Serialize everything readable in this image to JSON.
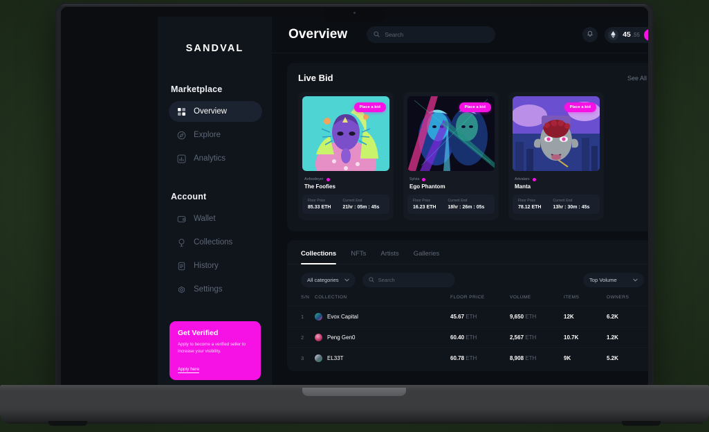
{
  "brand": {
    "logo": "SANDVAL"
  },
  "sidebar": {
    "sections": [
      {
        "title": "Marketplace",
        "items": [
          {
            "label": "Overview",
            "icon": "grid-icon",
            "active": true
          },
          {
            "label": "Explore",
            "icon": "compass-icon",
            "active": false
          },
          {
            "label": "Analytics",
            "icon": "chart-icon",
            "active": false
          }
        ]
      },
      {
        "title": "Account",
        "items": [
          {
            "label": "Wallet",
            "icon": "wallet-icon",
            "active": false
          },
          {
            "label": "Collections",
            "icon": "trophy-icon",
            "active": false
          },
          {
            "label": "History",
            "icon": "document-icon",
            "active": false
          },
          {
            "label": "Settings",
            "icon": "gear-icon",
            "active": false
          }
        ]
      }
    ],
    "promo": {
      "title": "Get Verified",
      "body": "Apply to become a verified seller to increase your visibility.",
      "link": "Apply here",
      "color": "#f612e4"
    }
  },
  "header": {
    "title": "Overview",
    "search_placeholder": "Search",
    "search_value": "",
    "balance_int": "45",
    "balance_dec": ".55"
  },
  "live_bid": {
    "title": "Live Bid",
    "see_all": "See All",
    "floor_label": "Floor Price",
    "end_label": "Current End",
    "bid_label": "Place a bid",
    "cards": [
      {
        "creator": "Aofoodeyer",
        "name": "The Foofies",
        "floor": "85.33 ETH",
        "end": "21hr : 05m : 45s"
      },
      {
        "creator": "Sylvia",
        "name": "Ego Phantom",
        "floor": "16.23 ETH",
        "end": "18hr : 26m : 05s"
      },
      {
        "creator": "Artvatars",
        "name": "Manta",
        "floor": "78.12 ETH",
        "end": "13hr : 30m : 45s"
      }
    ]
  },
  "browser": {
    "tabs": [
      {
        "label": "Collections",
        "active": true
      },
      {
        "label": "NFTs",
        "active": false
      },
      {
        "label": "Artists",
        "active": false
      },
      {
        "label": "Galleries",
        "active": false
      }
    ],
    "category_filter": "All categories",
    "search_placeholder": "Search",
    "search_value": "",
    "sort_filter": "Top Volume",
    "columns": [
      "S/N",
      "COLLECTION",
      "FLOOR PRICE",
      "VOLUME",
      "ITEMS",
      "OWNERS"
    ],
    "rows": [
      {
        "sn": "1",
        "collection": "Evox Capital",
        "floor": "45.67",
        "floor_unit": "ETH",
        "volume": "9,650",
        "volume_unit": "ETH",
        "items": "12K",
        "owners": "6.2K"
      },
      {
        "sn": "2",
        "collection": "Peng Gen0",
        "floor": "60.40",
        "floor_unit": "ETH",
        "volume": "2,567",
        "volume_unit": "ETH",
        "items": "10.7K",
        "owners": "1.2K"
      },
      {
        "sn": "3",
        "collection": "EL33T",
        "floor": "60.78",
        "floor_unit": "ETH",
        "volume": "8,908",
        "volume_unit": "ETH",
        "items": "9K",
        "owners": "5.2K"
      }
    ]
  }
}
